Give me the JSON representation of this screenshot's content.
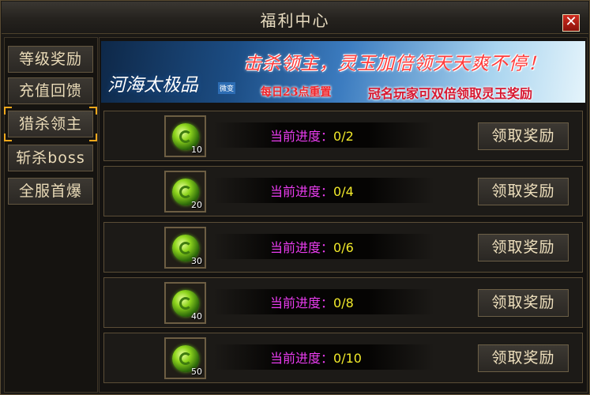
{
  "window": {
    "title": "福利中心",
    "close_label": "✕"
  },
  "sidebar": {
    "items": [
      {
        "label": "等级奖励",
        "active": false
      },
      {
        "label": "充值回馈",
        "active": false
      },
      {
        "label": "猎杀领主",
        "active": true
      },
      {
        "label": "斩杀boss",
        "active": false
      },
      {
        "label": "全服首爆",
        "active": false
      }
    ]
  },
  "banner": {
    "logo_text": "河海太极品",
    "logo_tag": "微变",
    "headline": "击杀领主，灵玉加倍领天天爽不停！",
    "reset_text": "每日23点重置",
    "subline": "冠名玩家可双倍领取灵玉奖励"
  },
  "rewards": [
    {
      "level": "10",
      "progress_label": "当前进度：",
      "progress_value": "0/2",
      "claim_label": "领取奖励"
    },
    {
      "level": "20",
      "progress_label": "当前进度：",
      "progress_value": "0/4",
      "claim_label": "领取奖励"
    },
    {
      "level": "30",
      "progress_label": "当前进度：",
      "progress_value": "0/6",
      "claim_label": "领取奖励"
    },
    {
      "level": "40",
      "progress_label": "当前进度：",
      "progress_value": "0/8",
      "claim_label": "领取奖励"
    },
    {
      "level": "50",
      "progress_label": "当前进度：",
      "progress_value": "0/10",
      "claim_label": "领取奖励"
    }
  ],
  "colors": {
    "accent": "#f0a81c",
    "progress_label": "#ea3cf0",
    "progress_value": "#f2ea2a",
    "close_bg": "#c0201a"
  }
}
